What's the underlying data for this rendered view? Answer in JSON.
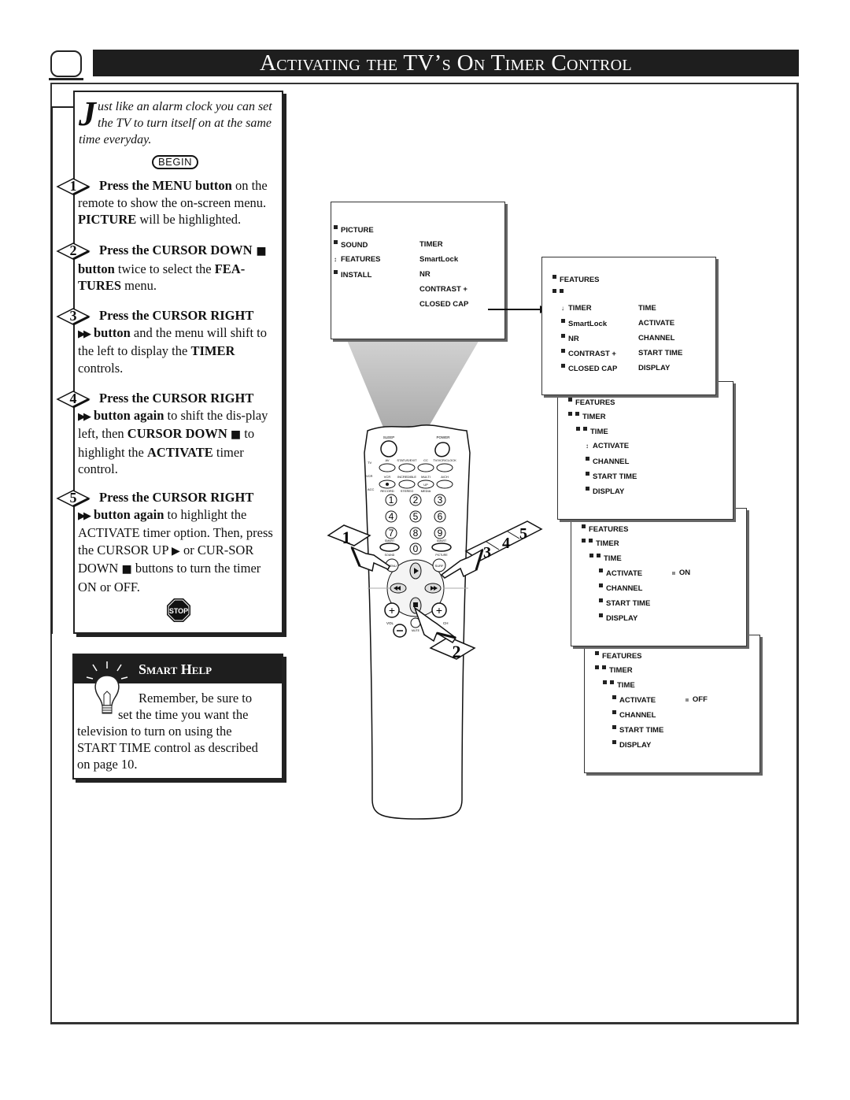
{
  "header": {
    "title": "Activating the TV’s On Timer Control",
    "tv_icon": "tv-icon"
  },
  "intro": {
    "dropcap": "J",
    "text": "ust like an alarm clock you can set the TV to turn itself on at the same time everyday.",
    "begin_label": "BEGIN"
  },
  "steps": [
    {
      "num": "1",
      "first": "Press the MENU button",
      "first_tail": " on the",
      "rest_html": "remote to show the on-screen menu. <b>PICTURE</b> will be highlighted."
    },
    {
      "num": "2",
      "first": "Press the CURSOR DOWN",
      "first_tail": " ■",
      "rest_html": "<b>button</b> twice to select the <b>FEA-TURES</b> menu."
    },
    {
      "num": "3",
      "first": "Press the CURSOR RIGHT",
      "first_tail": "",
      "rest_html": "<span class='arrows'>▶▶</span><b>button</b> and the menu will shift to the left to display the <b>TIMER</b> controls."
    },
    {
      "num": "4",
      "first": "Press the CURSOR RIGHT",
      "first_tail": "",
      "rest_html": "<span class='arrows'>▶▶</span><b>button again</b> to shift the dis-play left, then <b>CURSOR DOWN</b> <span class='sq'>■</span> to highlight the <b>ACTIVATE</b> timer control."
    },
    {
      "num": "5",
      "first": "Press the CURSOR RIGHT",
      "first_tail": "",
      "rest_html": "<span class='arrows'>▶▶</span><b>button again</b> to highlight the ACTIVATE timer option. Then, press the CURSOR UP <span class='sq'>▶</span> or CUR-SOR DOWN <span class='sq'>■</span> buttons to turn the timer ON or OFF."
    }
  ],
  "stop_label": "STOP",
  "smart_help": {
    "title": "Smart Help",
    "line1": "Remember, be sure to",
    "line2": "set the time you want the",
    "line3": "television to turn on using the",
    "line4": "START TIME control as described",
    "line5": "on page 10."
  },
  "menus": {
    "main": {
      "col1": [
        "PICTURE",
        "SOUND",
        "FEATURES",
        "INSTALL"
      ],
      "col2": [
        "TIMER",
        "SmartLock",
        "NR",
        "CONTRAST +",
        "CLOSED CAP"
      ]
    },
    "features": {
      "title": "FEATURES",
      "col1": [
        "TIMER",
        "SmartLock",
        "NR",
        "CONTRAST +",
        "CLOSED CAP"
      ],
      "col2": [
        "TIME",
        "ACTIVATE",
        "CHANNEL",
        "START TIME",
        "DISPLAY"
      ]
    },
    "timer": {
      "title": "FEATURES",
      "sub": "TIMER",
      "subsub": "TIME",
      "items": [
        "ACTIVATE",
        "CHANNEL",
        "START TIME",
        "DISPLAY"
      ]
    },
    "activate_on": {
      "title": "FEATURES",
      "sub": "TIMER",
      "subsub": "TIME",
      "items": [
        "ACTIVATE",
        "CHANNEL",
        "START TIME",
        "DISPLAY"
      ],
      "value": "ON"
    },
    "activate_off": {
      "title": "FEATURES",
      "sub": "TIMER",
      "subsub": "TIME",
      "items": [
        "ACTIVATE",
        "CHANNEL",
        "START TIME",
        "DISPLAY"
      ],
      "value": "OFF"
    }
  },
  "remote": {
    "labels": {
      "sleep": "SLEEP",
      "power": "POWER",
      "tv": "TV",
      "vcr": "VCR",
      "acc": "ACC",
      "av": "AV",
      "status": "STATUS/EXIT",
      "cc": "CC",
      "tvvcr": "TV/VCR/CLOCK",
      "vcr_btn": "VCR",
      "incredible": "INCREDIBLE",
      "multi": "MULTI",
      "ach": "A/CH",
      "record": "RECORD",
      "stereo": "STEREO",
      "media": "MEDIA",
      "smart_sound": "SMART",
      "sound": "SOUND",
      "smart_picture": "SMART",
      "picture": "PICTURE",
      "menu": "MENU",
      "surf": "SURF",
      "vol": "VOL",
      "ch": "CH",
      "mute": "MUTE",
      "up": "UP"
    },
    "digits": [
      "1",
      "2",
      "3",
      "4",
      "5",
      "6",
      "7",
      "8",
      "9",
      "0"
    ]
  },
  "callouts": [
    "1",
    "2",
    "3",
    "4",
    "5"
  ]
}
